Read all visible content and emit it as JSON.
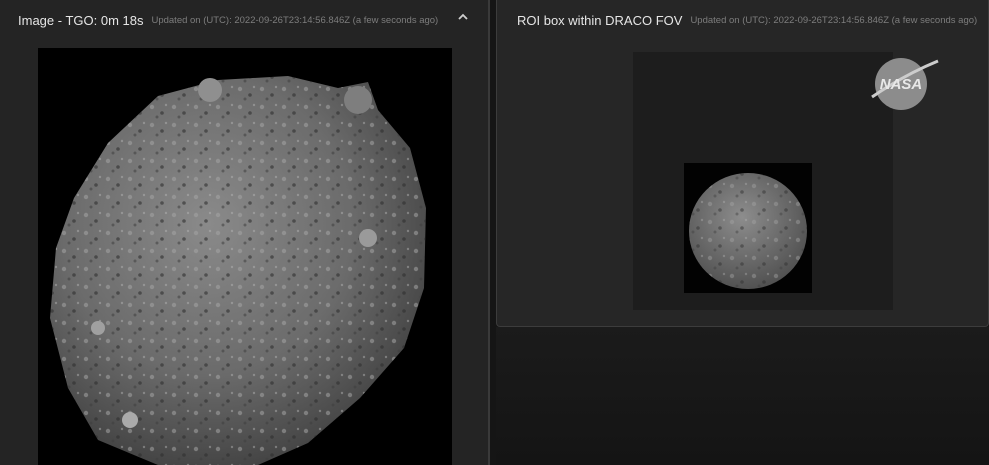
{
  "left_panel": {
    "title": "Image - TGO: 0m 18s",
    "updated": "Updated on (UTC): 2022-09-26T23:14:56.846Z (a few seconds ago)",
    "collapse_icon": "chevron-up-icon"
  },
  "right_panel": {
    "title": "ROI box within DRACO FOV",
    "updated": "Updated on (UTC): 2022-09-26T23:14:56.846Z (a few seconds ago)",
    "logo_text": "NASA"
  },
  "colors": {
    "panel_bg": "#242424",
    "title_text": "#e6e6e6",
    "muted_text": "#7d7d7d",
    "image_bg": "#000000"
  }
}
